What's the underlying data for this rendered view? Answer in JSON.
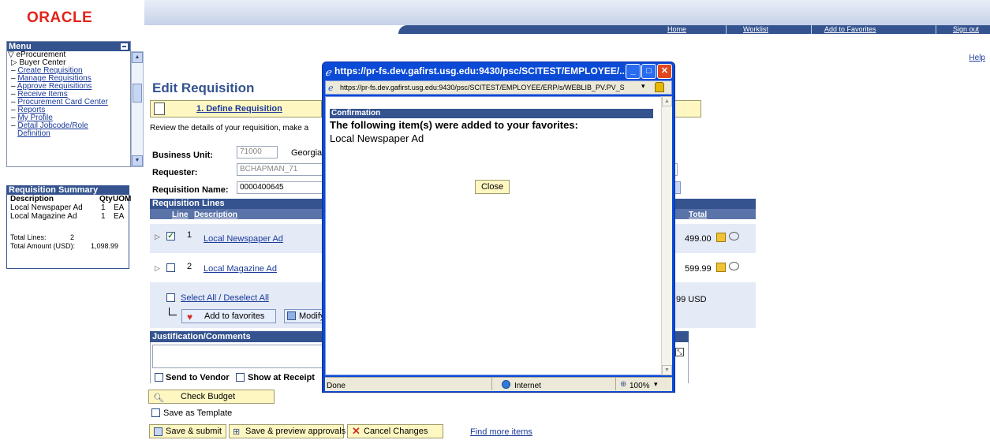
{
  "header": {
    "logo": "ORACLE",
    "nav": [
      "Home",
      "Worklist",
      "Add to Favorites",
      "Sign out"
    ],
    "help": "Help"
  },
  "menu": {
    "title": "Menu",
    "items": [
      {
        "label": "eProcurement",
        "glyph": "▽"
      },
      {
        "label": "Buyer Center",
        "glyph": "▷"
      },
      {
        "label": "Create Requisition",
        "glyph": "–"
      },
      {
        "label": "Manage Requisitions",
        "glyph": "–"
      },
      {
        "label": "Approve Requisitions",
        "glyph": "–"
      },
      {
        "label": "Receive Items",
        "glyph": "–"
      },
      {
        "label": "Procurement Card Center",
        "glyph": "–"
      },
      {
        "label": "Reports",
        "glyph": "–"
      },
      {
        "label": "My Profile",
        "glyph": "–"
      },
      {
        "label": "Detail Jobcode/Role",
        "glyph": "–"
      },
      {
        "label": "Definition",
        "glyph": ""
      }
    ]
  },
  "summary": {
    "title": "Requisition Summary",
    "col_desc": "Description",
    "col_qty": "Qty",
    "col_uom": "UOM",
    "rows": [
      {
        "desc": "Local Newspaper Ad",
        "qty": "1",
        "uom": "EA"
      },
      {
        "desc": "Local Magazine Ad",
        "qty": "1",
        "uom": "EA"
      }
    ],
    "total_lines_label": "Total Lines:",
    "total_lines": "2",
    "total_amount_label": "Total Amount (USD):",
    "total_amount": "1,098.99"
  },
  "main": {
    "title": "Edit Requisition",
    "step": "1. Define Requisition",
    "review_text": "Review the details of your requisition, make a",
    "business_unit_label": "Business Unit:",
    "business_unit": "71000",
    "business_unit_desc": "Georgia",
    "requester_label": "Requester:",
    "requester": "BCHAPMAN_71",
    "req_name_label": "Requisition Name:",
    "req_name": "0000400645",
    "lines_title": "Requisition Lines",
    "col_line": "Line",
    "col_desc": "Description",
    "col_total": "Total",
    "lines": [
      {
        "num": "1",
        "desc": "Local Newspaper Ad",
        "total": "499.00",
        "checked": true
      },
      {
        "num": "2",
        "desc": "Local Magazine Ad",
        "total": "599.99",
        "checked": false
      }
    ],
    "select_all": "Select All / Deselect All",
    "total_fragment": "99  USD",
    "add_favorites": "Add to favorites",
    "modify": "Modify",
    "just_title": "Justification/Comments",
    "send_to_vendor": "Send to Vendor",
    "show_at_receipt": "Show at Receipt",
    "check_budget": "Check Budget",
    "save_template": "Save as Template",
    "save_submit": "Save & submit",
    "save_preview": "Save & preview approvals",
    "cancel": "Cancel Changes",
    "find_more": "Find more items"
  },
  "popup": {
    "title": "https://pr-fs.dev.gafirst.usg.edu:9430/psc/SCITEST/EMPLOYEE/...",
    "url": "https://pr-fs.dev.gafirst.usg.edu:9430/psc/SCITEST/EMPLOYEE/ERP/s/WEBLIB_PV.PV_S",
    "conf_head": "Confirmation",
    "message": "The following item(s) were added to your favorites:",
    "item": "Local Newspaper Ad",
    "close": "Close",
    "status": "Done",
    "zone": "Internet",
    "zoom": "100%"
  }
}
